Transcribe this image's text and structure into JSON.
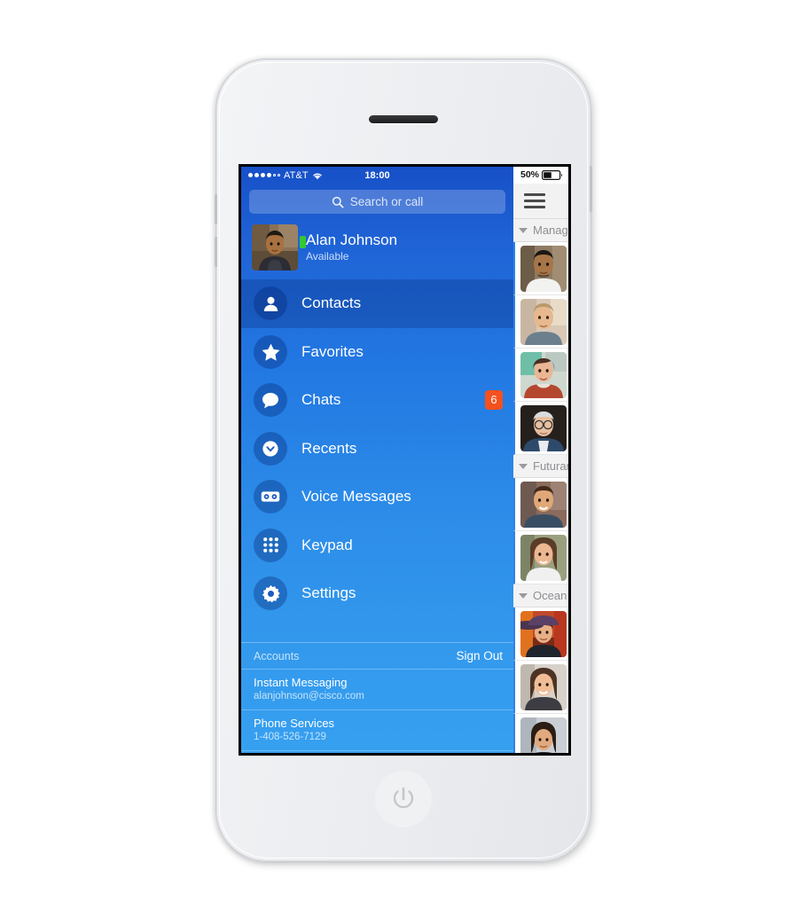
{
  "device": {
    "type": "white-smartphone",
    "home_button_icon": "power-icon",
    "earpiece": "speaker-slot"
  },
  "status_bar": {
    "signal_dots_filled": 4,
    "signal_dots_total": 6,
    "carrier": "AT&T",
    "wifi_icon": "wifi-icon",
    "time": "18:00",
    "battery_percent": "50%",
    "battery_level": 0.5
  },
  "search": {
    "placeholder": "Search or call",
    "icon": "search-icon"
  },
  "profile": {
    "name": "Alan Johnson",
    "status": "Available",
    "presence_color": "#35c734",
    "avatar": "photo-man-dark-hair"
  },
  "nav": {
    "items": [
      {
        "label": "Contacts",
        "icon": "person-icon",
        "active": true,
        "badge": ""
      },
      {
        "label": "Favorites",
        "icon": "star-icon",
        "active": false,
        "badge": ""
      },
      {
        "label": "Chats",
        "icon": "chat-bubble-icon",
        "active": false,
        "badge": "6"
      },
      {
        "label": "Recents",
        "icon": "clock-icon",
        "active": false,
        "badge": ""
      },
      {
        "label": "Voice Messages",
        "icon": "voicemail-icon",
        "active": false,
        "badge": ""
      },
      {
        "label": "Keypad",
        "icon": "keypad-grid-icon",
        "active": false,
        "badge": ""
      },
      {
        "label": "Settings",
        "icon": "gear-icon",
        "active": false,
        "badge": ""
      }
    ],
    "badge_color": "#f4511e"
  },
  "accounts": {
    "header": "Accounts",
    "sign_out": "Sign Out",
    "rows": [
      {
        "title": "Instant Messaging",
        "detail": "alanjohnson@cisco.com"
      },
      {
        "title": "Phone Services",
        "detail": "1-408-526-7129"
      }
    ]
  },
  "right_panel": {
    "menu_icon": "hamburger-menu-icon",
    "groups": [
      {
        "label": "Manag",
        "contacts": [
          "photo-man-beard",
          "photo-man-blond",
          "photo-woman-scarf",
          "photo-man-glasses-senior"
        ]
      },
      {
        "label": "Futuran",
        "contacts": [
          "photo-man-smiling",
          "photo-woman-brown-hair"
        ]
      },
      {
        "label": "Ocean",
        "contacts": [
          "photo-man-hat",
          "photo-woman-smiling",
          "photo-woman-dark-hair"
        ]
      }
    ]
  },
  "theme": {
    "gradient_top": "#1750c8",
    "gradient_bottom": "#36a0f0",
    "active_row": "#1c5bbd",
    "icon_circle": "rgba(3,35,110,.34)"
  }
}
